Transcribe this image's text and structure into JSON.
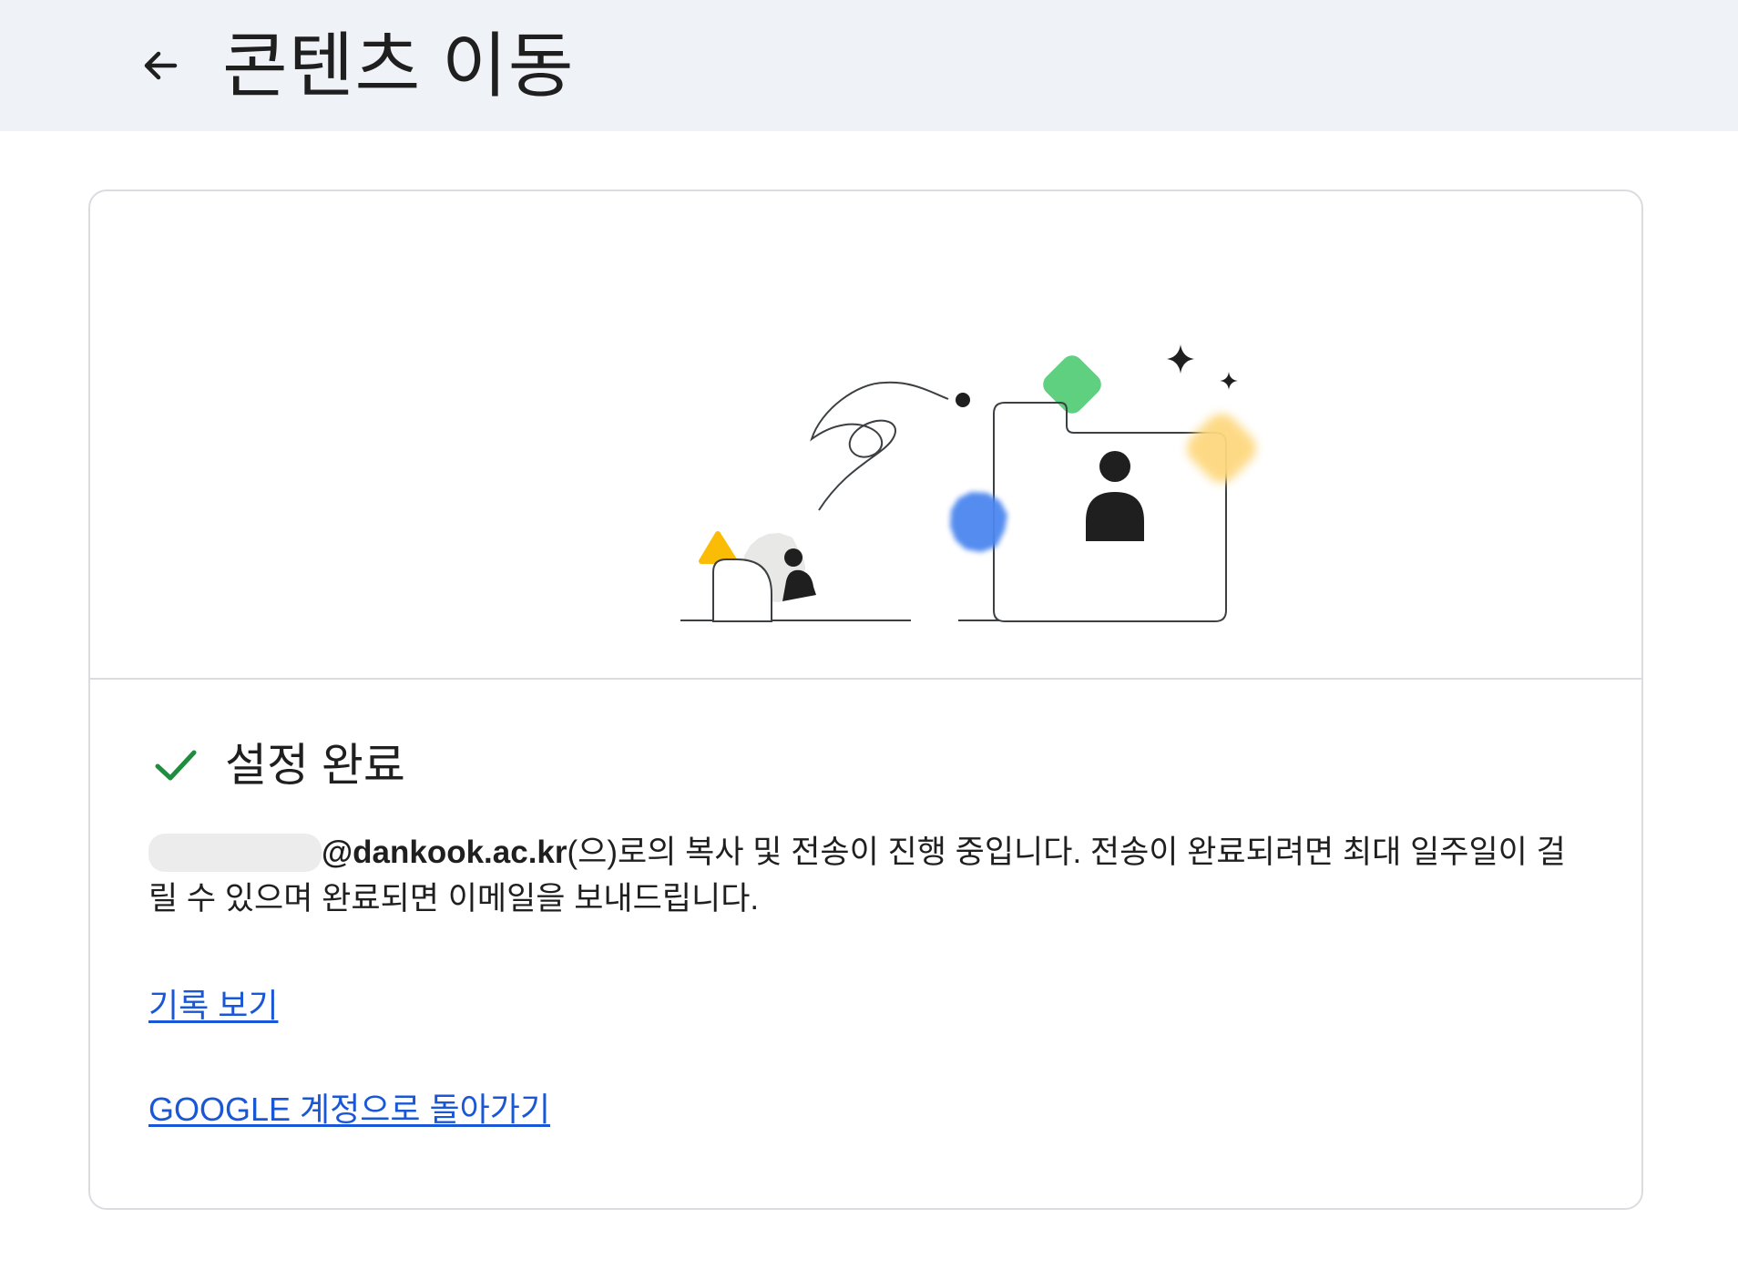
{
  "header": {
    "title": "콘텐츠 이동",
    "back_icon": "arrow-back-icon"
  },
  "status": {
    "icon": "check-icon",
    "icon_color": "#1e8e3e",
    "title": "설정 완료"
  },
  "message": {
    "email_domain": "@dankook.ac.kr",
    "text": "(으)로의 복사 및 전송이 진행 중입니다. 전송이 완료되려면 최대 일주일이 걸릴 수 있으며 완료되면 이메일을 보내드립니다."
  },
  "links": {
    "history": "기록 보기",
    "account": "GOOGLE 계정으로 돌아가기"
  },
  "colors": {
    "header_bg": "#eff3f8",
    "link": "#1a57d6",
    "border": "#dadce0",
    "green": "#5fcf80",
    "blue": "#4b86ef",
    "yellow": "#fdd880",
    "orange": "#fbbc05"
  }
}
